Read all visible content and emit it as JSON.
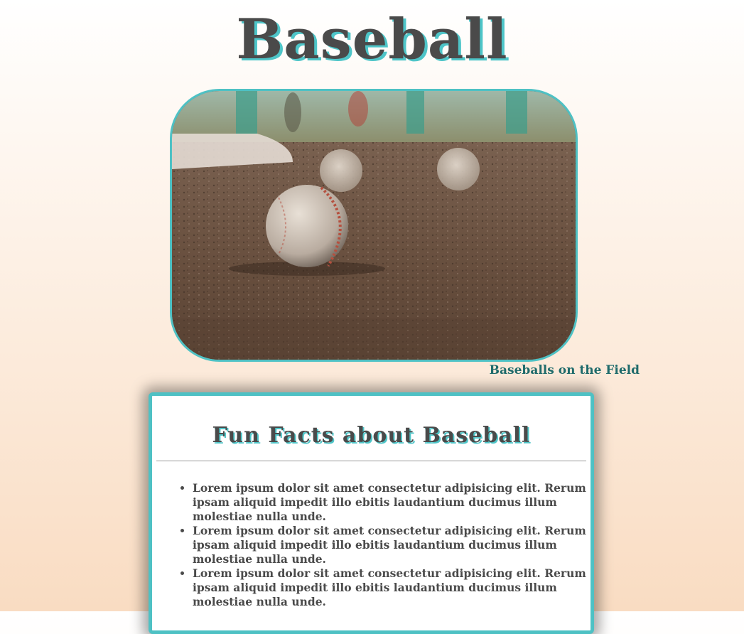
{
  "header": {
    "title": "Baseball"
  },
  "hero": {
    "image_icon": "baseball-photo",
    "caption": "Baseballs on the Field"
  },
  "facts": {
    "heading": "Fun Facts about Baseball",
    "items": [
      "Lorem ipsum dolor sit amet consectetur adipisicing elit. Rerum ipsam aliquid impedit illo ebitis laudantium ducimus illum molestiae nulla unde.",
      "Lorem ipsum dolor sit amet consectetur adipisicing elit. Rerum ipsam aliquid impedit illo ebitis laudantium ducimus illum molestiae nulla unde.",
      "Lorem ipsum dolor sit amet consectetur adipisicing elit. Rerum ipsam aliquid impedit illo ebitis laudantium ducimus illum molestiae nulla unde."
    ]
  },
  "colors": {
    "accent": "#4ec1c4",
    "text": "#4a4a4a",
    "caption": "#1f6b6b"
  }
}
